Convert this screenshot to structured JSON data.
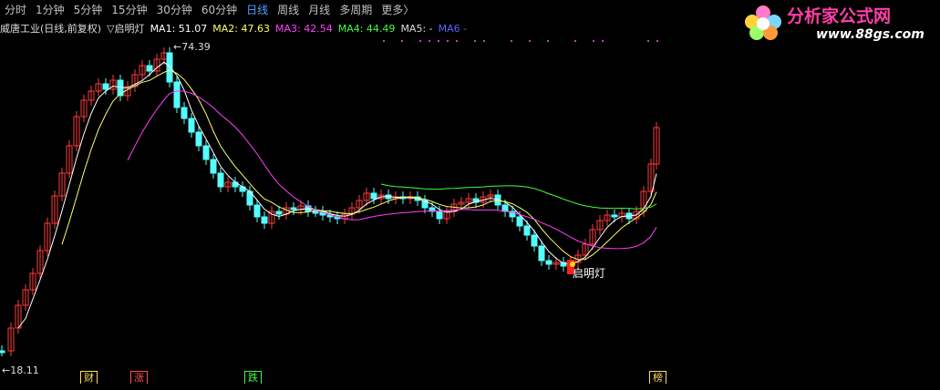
{
  "toolbar": {
    "items": [
      "分时",
      "1分钟",
      "5分钟",
      "15分钟",
      "30分钟",
      "60分钟",
      "日线",
      "周线",
      "月线",
      "多周期",
      "更多〉"
    ],
    "active": "日线"
  },
  "info": {
    "stock": "威唐工业(日线,前复权)",
    "indicator": "▽启明灯",
    "ma1": "MA1: 51.07",
    "ma2": "MA2: 47.63",
    "ma3": "MA3: 42.54",
    "ma4": "MA4: 44.49",
    "ma5": "MA5: -",
    "ma6": "MA6 -"
  },
  "colors": {
    "up": "#ff3b3b",
    "down": "#5ff",
    "ma1": "#ffffff",
    "ma2": "#ffff66",
    "ma3": "#ff40ff",
    "ma4": "#40ff40",
    "ma6": "#6060ff"
  },
  "logo": {
    "title": "分析家公式网",
    "url": "www.88gs.com"
  },
  "labels": {
    "high": "74.39",
    "low": "18.11",
    "signal": "启明灯"
  },
  "tags": [
    {
      "text": "财",
      "color": "#ffdd55"
    },
    {
      "text": "涨",
      "color": "#ff5050"
    },
    {
      "text": "跌",
      "color": "#40ff40"
    },
    {
      "text": "榜",
      "color": "#ffdd55"
    }
  ]
}
